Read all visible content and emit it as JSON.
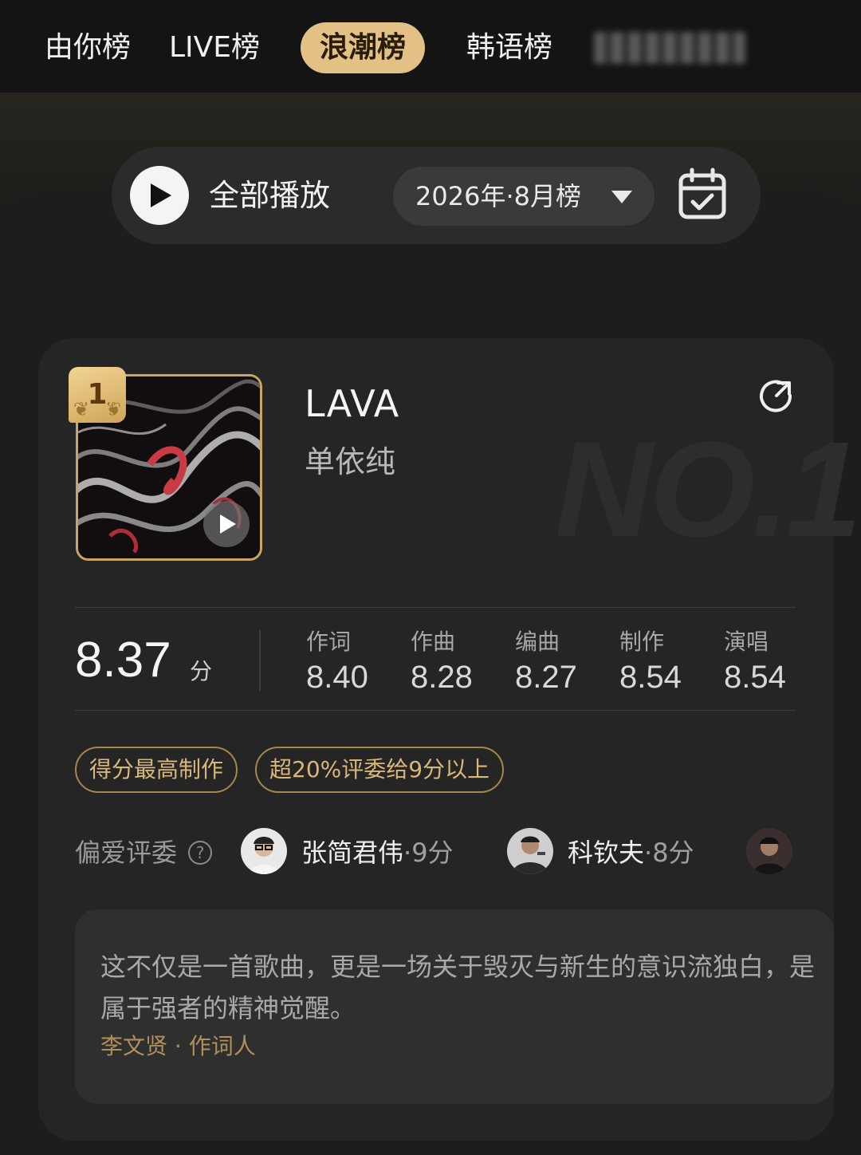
{
  "top_tabs": [
    {
      "label": "由你榜",
      "active": false
    },
    {
      "label": "LIVE榜",
      "active": false
    },
    {
      "label": "浪潮榜",
      "active": true
    },
    {
      "label": "韩语榜",
      "active": false
    },
    {
      "label": "",
      "active": false,
      "blurred": true
    }
  ],
  "toolbar": {
    "play_all_label": "全部播放",
    "period": "2026年·8月榜"
  },
  "song": {
    "rank": "1",
    "title": "LAVA",
    "artist": "单依纯",
    "watermark": "NO.1"
  },
  "scores": {
    "total": "8.37",
    "unit": "分",
    "breakdown": [
      {
        "label": "作词",
        "value": "8.40"
      },
      {
        "label": "作曲",
        "value": "8.28"
      },
      {
        "label": "编曲",
        "value": "8.27"
      },
      {
        "label": "制作",
        "value": "8.54"
      },
      {
        "label": "演唱",
        "value": "8.54"
      }
    ]
  },
  "tags": [
    "得分最高制作",
    "超20%评委给9分以上"
  ],
  "judges": {
    "label": "偏爱评委",
    "list": [
      {
        "name": "张简君伟",
        "score": "·9分"
      },
      {
        "name": "科钦夫",
        "score": "·8分"
      }
    ]
  },
  "comment": {
    "text": "这不仅是一首歌曲，更是一场关于毁灭与新生的意识流独白，是属于强者的精神觉醒。",
    "author": "李文贤 · 作词人"
  },
  "colors": {
    "accent_gold": "#e3c186",
    "tag_border": "#a7864d",
    "background": "#1b1b1b",
    "card": "#252525"
  }
}
